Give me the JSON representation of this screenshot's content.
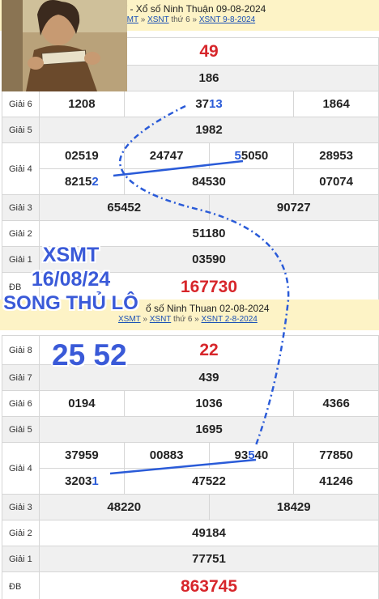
{
  "top": {
    "header": {
      "title": "T - Xổ số Ninh Thuận 09-08-2024",
      "crumb1": "SMT",
      "crumb2": "XSNT",
      "crumb_sep": "»",
      "crumb3": "thứ 6",
      "crumb4": "XSNT 9-8-2024"
    },
    "g8": "49",
    "g7": "186",
    "g6": [
      "1208",
      "37",
      "13",
      "1864"
    ],
    "g5": "1982",
    "g4_row1": [
      "02519",
      "24747",
      "5",
      "5050",
      "28953"
    ],
    "g4_row2": [
      "8215",
      "2",
      "84530",
      "07074"
    ],
    "g3": [
      "65452",
      "90727"
    ],
    "g2": "51180",
    "g1": "03590",
    "db": "167730"
  },
  "bottom": {
    "header": {
      "title": "ổ số Ninh Thuan 02-08-2024",
      "crumb1": "XSMT",
      "crumb2": "XSNT",
      "crumb_sep": "»",
      "crumb3": "thứ 6",
      "crumb4": "XSNT 2-8-2024"
    },
    "g8": "22",
    "g7": "439",
    "g6": [
      "0194",
      "1036",
      "4366"
    ],
    "g5": "1695",
    "g4_row1": [
      "37959",
      "00883",
      "93",
      "5",
      "40",
      "77850"
    ],
    "g4_row2": [
      "3203",
      "1",
      "47522",
      "41246"
    ],
    "g3": [
      "48220",
      "18429"
    ],
    "g2": "49184",
    "g1": "77751",
    "db": "863745"
  },
  "labels": {
    "g8": "Giải 8",
    "g7": "Giải 7",
    "g6": "Giải 6",
    "g5": "Giải 5",
    "g4": "Giải 4",
    "g3": "Giải 3",
    "g2": "Giải 2",
    "g1": "Giải 1",
    "db": "ĐB"
  },
  "promo": {
    "line1": "XSMT",
    "line2": "16/08/24",
    "line3": "SONG THỦ LÔ",
    "pair": "25 52"
  },
  "colors": {
    "header_bg": "#fdf3c6",
    "prize_red": "#d7262b",
    "highlight_blue": "#2a5bd8",
    "alt_row": "#f0f0f0"
  },
  "image": "man-holding-book-photo"
}
